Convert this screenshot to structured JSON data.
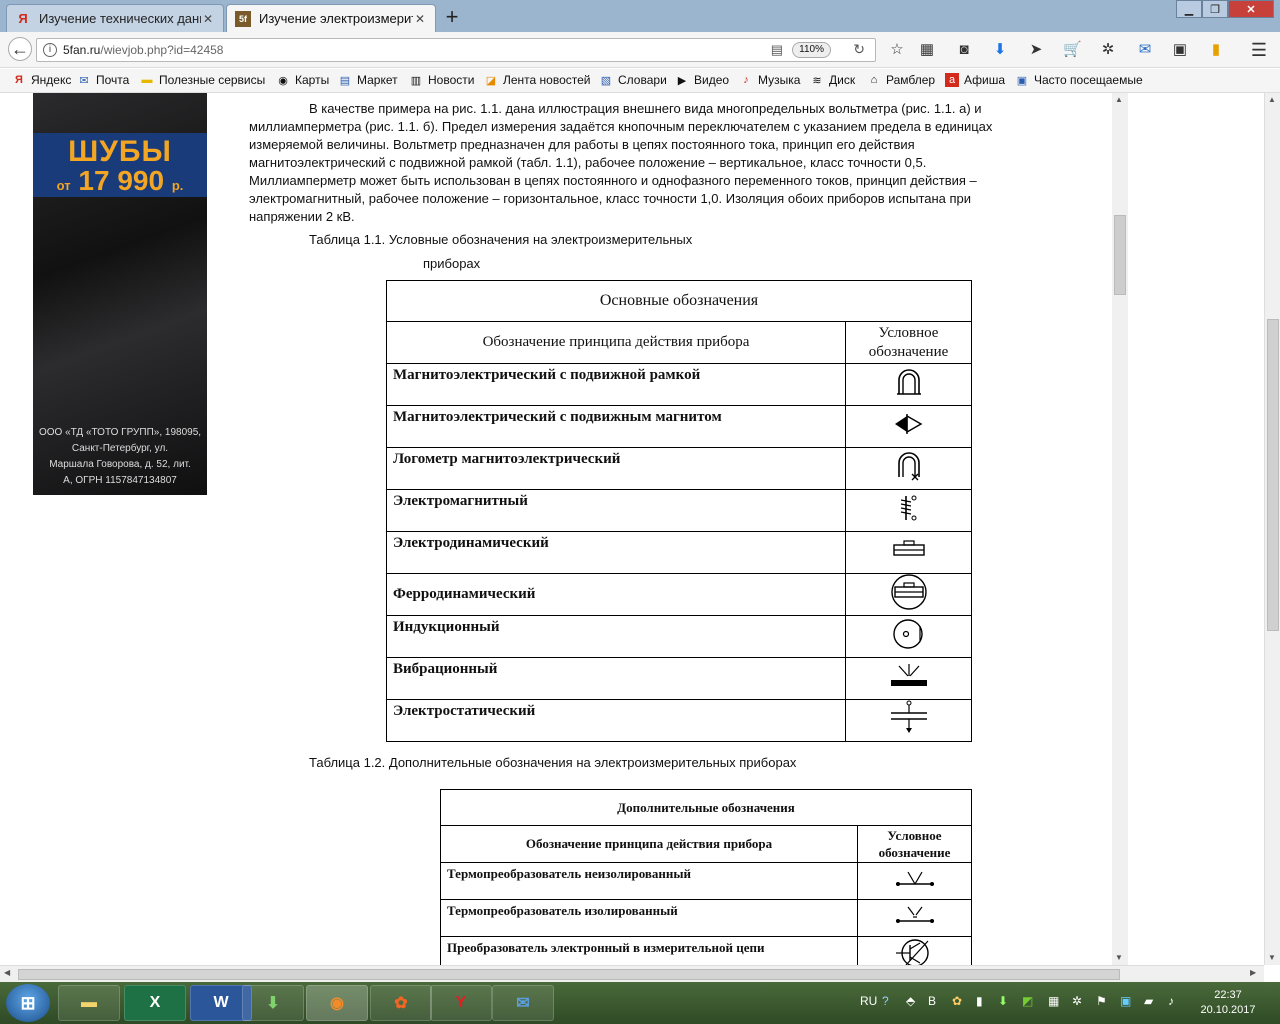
{
  "browser": {
    "tabs": [
      {
        "title": "Изучение технических данн",
        "favicon": "yandex-icon",
        "active": false
      },
      {
        "title": "Изучение электроизмерите",
        "favicon": "site-icon",
        "active": true
      }
    ],
    "url_host": "5fan.ru",
    "url_path": "/wievjob.php?id=42458",
    "zoom": "110%"
  },
  "bookmarks": [
    {
      "label": "Яндекс",
      "icon": "yandex-icon"
    },
    {
      "label": "Почта",
      "icon": "mail-icon"
    },
    {
      "label": "Полезные сервисы",
      "icon": "folder-icon"
    },
    {
      "label": "Карты",
      "icon": "map-icon"
    },
    {
      "label": "Маркет",
      "icon": "market-icon"
    },
    {
      "label": "Новости",
      "icon": "news-icon"
    },
    {
      "label": "Лента новостей",
      "icon": "rss-icon"
    },
    {
      "label": "Словари",
      "icon": "dictionary-icon"
    },
    {
      "label": "Видео",
      "icon": "video-icon"
    },
    {
      "label": "Музыка",
      "icon": "music-icon"
    },
    {
      "label": "Диск",
      "icon": "disk-icon"
    },
    {
      "label": "Рамблер",
      "icon": "home-icon"
    },
    {
      "label": "Афиша",
      "icon": "afisha-icon"
    },
    {
      "label": "Часто посещаемые",
      "icon": "history-icon"
    }
  ],
  "ad": {
    "headline": "ШУБЫ",
    "price_prefix": "от",
    "price": "17 990",
    "price_suffix": "р.",
    "legal_1": "ООО «ТД «ТОТО ГРУПП», 198095,",
    "legal_2": "Санкт-Петербург, ул.",
    "legal_3": "Маршала Говорова, д. 52, лит.",
    "legal_4": "А, ОГРН 1157847134807"
  },
  "article": {
    "para_lines": [
      "В качестве примера на рис. 1.1. дана иллюстрация внешнего вида многопредельных вольтметра (рис. 1.1. а) и",
      "миллиамперметра (рис. 1.1. б). Предел измерения задаётся кнопочным переключателем с указанием предела в единицах",
      "измеряемой величины. Вольтметр предназначен для работы в цепях постоянного тока, принцип его действия",
      "магнитоэлектрический с подвижной рамкой (табл. 1.1), рабочее положение – вертикальное, класс точности 0,5.",
      "Миллиамперметр может быть использован в цепях постоянного и однофазного переменного токов, принцип действия –",
      "электромагнитный, рабочее положение – горизонтальное, класс точности 1,0. Изоляция обоих приборов испытана при",
      "напряжении 2 кВ."
    ],
    "table1_caption_1": "Таблица 1.1. Условные обозначения на электроизмерительных",
    "table1_caption_2": "приборах",
    "table1": {
      "title": "Основные обозначения",
      "col1": "Обозначение принципа действия прибора",
      "col2_1": "Условное",
      "col2_2": "обозначение",
      "rows": [
        {
          "name": "Магнитоэлектрический с подвижной рамкой",
          "symbol": "moving-coil-symbol"
        },
        {
          "name": "Магнитоэлектрический с подвижным магнитом",
          "symbol": "moving-magnet-symbol"
        },
        {
          "name": "Логометр магнитоэлектрический",
          "symbol": "ratiometer-symbol"
        },
        {
          "name": "Электромагнитный",
          "symbol": "electromagnetic-symbol"
        },
        {
          "name": "Электродинамический",
          "symbol": "electrodynamic-symbol"
        },
        {
          "name": "Ферродинамический",
          "symbol": "ferrodynamic-symbol"
        },
        {
          "name": "Индукционный",
          "symbol": "induction-symbol"
        },
        {
          "name": "Вибрационный",
          "symbol": "vibration-symbol"
        },
        {
          "name": "Электростатический",
          "symbol": "electrostatic-symbol"
        }
      ]
    },
    "table2_caption": "Таблица 1.2. Дополнительные обозначения на электроизмерительных приборах",
    "table2": {
      "title": "Дополнительные обозначения",
      "col1": "Обозначение принципа действия прибора",
      "col2_1": "Условное",
      "col2_2": "обозначение",
      "rows": [
        {
          "name": "Термопреобразователь неизолированный",
          "symbol": "thermo-uninsulated-symbol"
        },
        {
          "name": "Термопреобразователь изолированный",
          "symbol": "thermo-insulated-symbol"
        },
        {
          "name": "Преобразователь электронный в измерительной цепи",
          "symbol": "electronic-converter-symbol"
        }
      ]
    }
  },
  "taskbar": {
    "apps": [
      "explorer-icon",
      "excel-icon",
      "word-icon",
      "download-icon",
      "firefox-icon",
      "media-player-icon",
      "yandex-browser-icon",
      "thunderbird-icon"
    ],
    "lang": "RU",
    "time": "22:37",
    "date": "20.10.2017"
  }
}
